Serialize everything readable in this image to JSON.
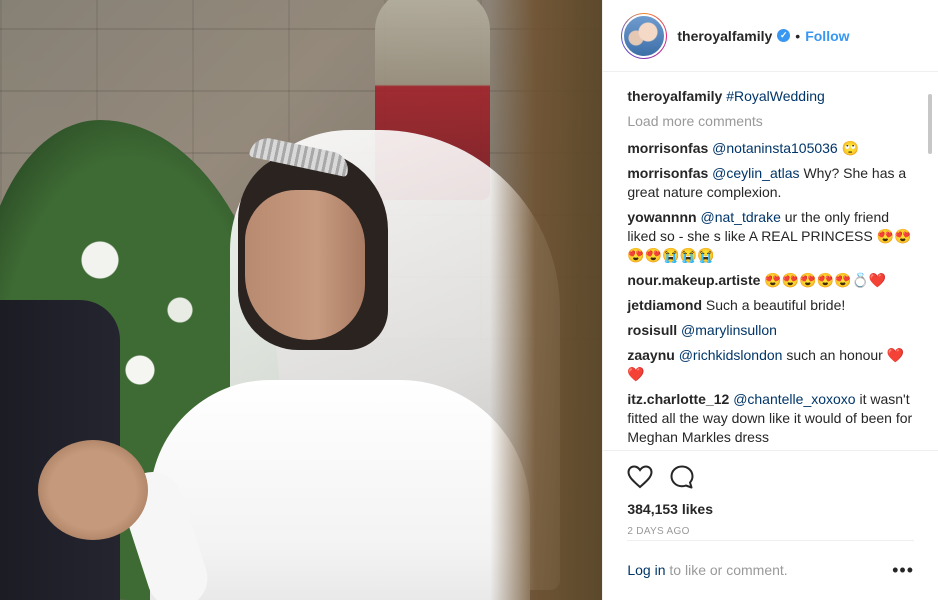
{
  "photo": {
    "alt": ""
  },
  "header": {
    "username": "theroyalfamily",
    "verified_icon": "verified-check-icon",
    "dot": "•",
    "follow_label": "Follow"
  },
  "caption": {
    "username": "theroyalfamily",
    "hashtag": "#RoyalWedding"
  },
  "load_more": "Load more comments",
  "comments": [
    {
      "user": "morrisonfas",
      "mention": "@notaninsta105036",
      "text": "",
      "emoji": "🙄"
    },
    {
      "user": "morrisonfas",
      "mention": "@ceylin_atlas",
      "text": "Why? She has a great nature complexion.",
      "emoji": ""
    },
    {
      "user": "yowannnn",
      "mention": "@nat_tdrake",
      "text": "ur the only friend liked so - she s like A REAL PRINCESS",
      "emoji": "😍😍😍😍😭😭😭"
    },
    {
      "user": "nour.makeup.artiste",
      "mention": "",
      "text": "",
      "emoji": "😍😍😍😍😍💍❤️"
    },
    {
      "user": "jetdiamond",
      "mention": "",
      "text": "Such a beautiful bride!",
      "emoji": ""
    },
    {
      "user": "rosisull",
      "mention": "@marylinsullon",
      "text": "",
      "emoji": ""
    },
    {
      "user": "zaaynu",
      "mention": "@richkidslondon",
      "text": "such an honour",
      "emoji": "❤️❤️"
    },
    {
      "user": "itz.charlotte_12",
      "mention": "@chantelle_xoxoxo",
      "text": "it wasn't fitted all the way down like it would of been for Meghan Markles dress",
      "emoji": ""
    }
  ],
  "actions": {
    "like_icon": "heart-icon",
    "comment_icon": "comment-icon"
  },
  "likes": "384,153 likes",
  "date": "2 DAYS AGO",
  "footer": {
    "login": "Log in",
    "rest": "to like or comment.",
    "more": "•••"
  }
}
